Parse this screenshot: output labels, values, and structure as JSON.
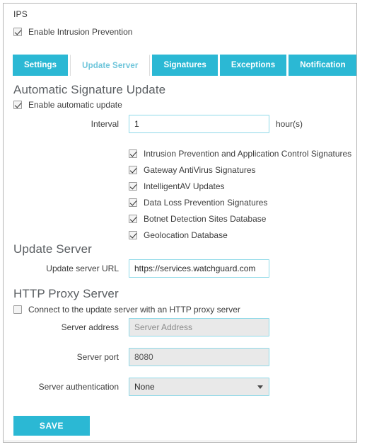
{
  "header": {
    "page_title": "IPS",
    "enable_label": "Enable Intrusion Prevention",
    "enable_checked": true
  },
  "tabs": [
    {
      "label": "Settings",
      "active": false
    },
    {
      "label": "Update Server",
      "active": true
    },
    {
      "label": "Signatures",
      "active": false
    },
    {
      "label": "Exceptions",
      "active": false
    },
    {
      "label": "Notification",
      "active": false
    }
  ],
  "automatic_signature_update": {
    "heading": "Automatic Signature Update",
    "enable_label": "Enable automatic update",
    "enable_checked": true,
    "interval_label": "Interval",
    "interval_value": "1",
    "interval_suffix": "hour(s)",
    "signature_items": [
      {
        "label": "Intrusion Prevention and Application Control Signatures",
        "checked": true
      },
      {
        "label": "Gateway AntiVirus Signatures",
        "checked": true
      },
      {
        "label": "IntelligentAV Updates",
        "checked": true
      },
      {
        "label": "Data Loss Prevention Signatures",
        "checked": true
      },
      {
        "label": "Botnet Detection Sites Database",
        "checked": true
      },
      {
        "label": "Geolocation Database",
        "checked": true
      }
    ]
  },
  "update_server": {
    "heading": "Update Server",
    "url_label": "Update server URL",
    "url_value": "https://services.watchguard.com"
  },
  "http_proxy_server": {
    "heading": "HTTP Proxy Server",
    "enable_label": "Connect to the update server with an HTTP proxy server",
    "enable_checked": false,
    "address_label": "Server address",
    "address_value": "",
    "address_placeholder": "Server Address",
    "port_label": "Server port",
    "port_value": "8080",
    "auth_label": "Server authentication",
    "auth_value": "None"
  },
  "actions": {
    "save_label": "SAVE"
  },
  "colors": {
    "accent": "#2bb8d4",
    "active_tab_text": "#6fc6db",
    "input_border": "#8ed9e8",
    "disabled_field": "#e9e9e9"
  }
}
